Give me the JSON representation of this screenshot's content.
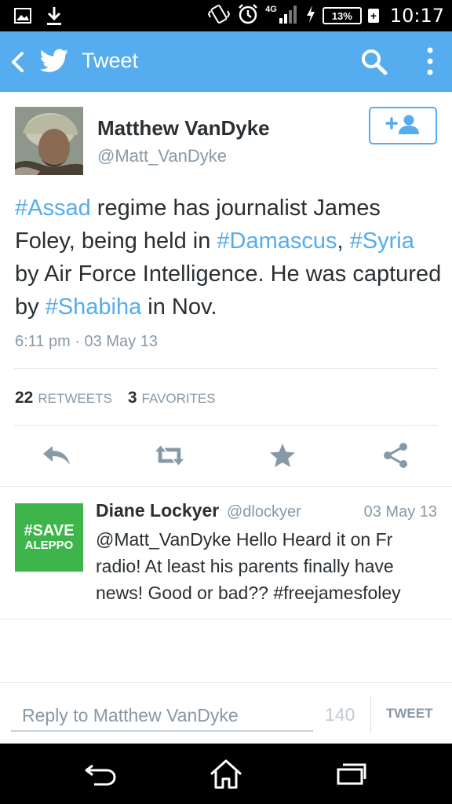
{
  "status_bar": {
    "time": "10:17",
    "battery": "13%",
    "network": "4G",
    "icons": [
      "gallery-icon",
      "download-icon",
      "vibrate-icon",
      "alarm-icon",
      "signal-icon",
      "charging-icon",
      "battery-icon"
    ]
  },
  "app_bar": {
    "title": "Tweet",
    "background": "#55acee",
    "icons": [
      "back-icon",
      "twitter-bird-icon",
      "search-icon",
      "overflow-menu-icon"
    ]
  },
  "tweet": {
    "author_name": "Matthew VanDyke",
    "author_handle": "@Matt_VanDyke",
    "follow_icon": "add-user-icon",
    "segments": [
      {
        "text": "#Assad",
        "hashtag": true
      },
      {
        "text": " regime has journalist James Foley, being held in ",
        "hashtag": false
      },
      {
        "text": "#Damascus",
        "hashtag": true
      },
      {
        "text": ", ",
        "hashtag": false
      },
      {
        "text": "#Syria",
        "hashtag": true
      },
      {
        "text": " by Air Force Intelligence. He was captured by ",
        "hashtag": false
      },
      {
        "text": "#Shabiha",
        "hashtag": true
      },
      {
        "text": " in Nov.",
        "hashtag": false
      }
    ],
    "timestamp": "6:11 pm · 03 May 13",
    "retweets_count": "22",
    "retweets_label": "RETWEETS",
    "favorites_count": "3",
    "favorites_label": "FAVORITES",
    "actions": [
      "reply-icon",
      "retweet-icon",
      "favorite-star-icon",
      "share-icon"
    ]
  },
  "reply": {
    "avatar_line1": "#SAVE",
    "avatar_line2": "ALEPPO",
    "avatar_color": "#3db54a",
    "name": "Diane Lockyer",
    "handle": "@dlockyer",
    "date": "03 May 13",
    "text": "@Matt_VanDyke Hello Heard it on Fr radio! At least his parents finally have news! Good or bad?? #freejamesfoley"
  },
  "compose": {
    "placeholder": "Reply to Matthew VanDyke",
    "char_count": "140",
    "tweet_button": "TWEET"
  },
  "nav_bar": {
    "icons": [
      "back-nav-icon",
      "home-icon",
      "recent-apps-icon"
    ]
  }
}
